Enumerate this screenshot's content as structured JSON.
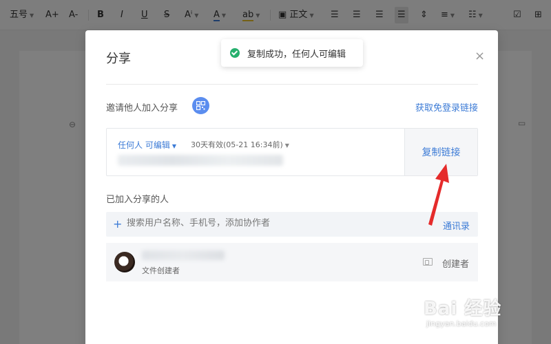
{
  "toolbar": {
    "font_size": "五号",
    "increase_font": "A+",
    "decrease_font": "A-",
    "bold": "B",
    "italic": "I",
    "underline": "U",
    "strike": "S",
    "superscript": "Aⁱ",
    "font_color": "A",
    "highlight": "ab",
    "paragraph_style": "正文"
  },
  "dialog": {
    "title": "分享",
    "invite_label": "邀请他人加入分享",
    "login_link": "获取免登录链接",
    "link_box": {
      "permission": "任何人 可编辑",
      "expire": "30天有效(05-21 16:34前)",
      "copy_label": "复制链接"
    },
    "joined_label": "已加入分享的人",
    "search": {
      "placeholder": "搜索用户名称、手机号，添加协作者",
      "contacts_label": "通讯录"
    },
    "member": {
      "subtitle": "文件创建者",
      "role": "创建者"
    }
  },
  "toast": {
    "message": "复制成功，任何人可编辑"
  },
  "watermark": {
    "main": "Bai 经验",
    "sub": "jingyan.baidu.com"
  },
  "colors": {
    "accent": "#3c7bd6",
    "success": "#27b06e",
    "annotation_arrow": "#e52b2b"
  }
}
